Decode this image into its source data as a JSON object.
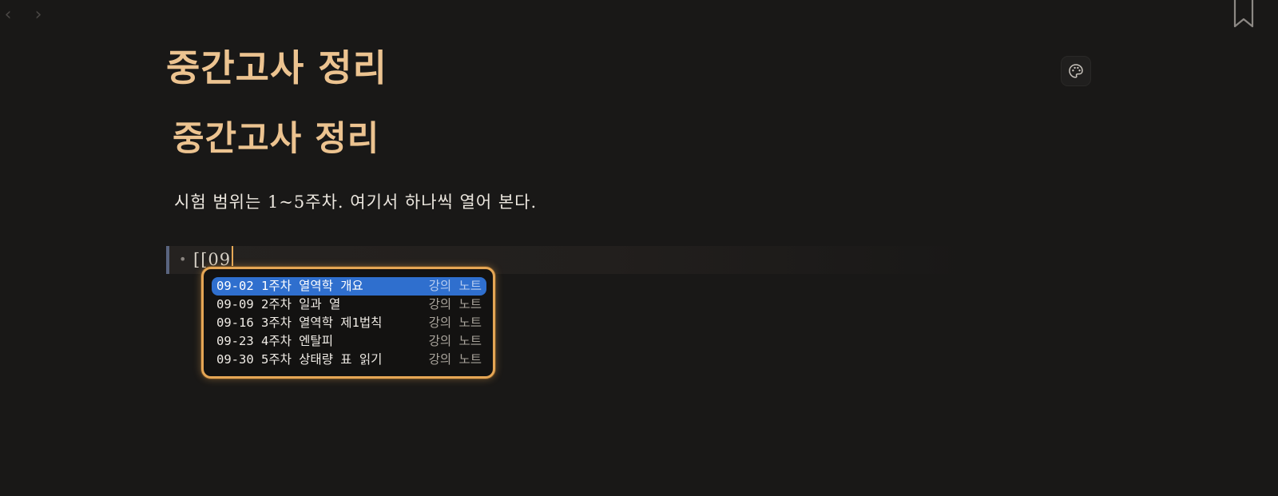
{
  "nav": {
    "back_icon": "chevron-left-icon",
    "forward_icon": "chevron-right-icon",
    "back_glyph": "‹",
    "forward_glyph": "›"
  },
  "toolbar": {
    "bookmark_icon": "bookmark-icon",
    "palette_icon": "palette-icon"
  },
  "document": {
    "title": "중간고사 정리",
    "heading": "중간고사 정리",
    "paragraph": "시험 범위는 1~5주차. 여기서 하나씩 열어 본다.",
    "bullet_input": "[[09"
  },
  "autocomplete": {
    "selected_index": 0,
    "items": [
      {
        "title": "09-02 1주차 열역학 개요",
        "kind": "강의 노트"
      },
      {
        "title": "09-09 2주차 일과 열",
        "kind": "강의 노트"
      },
      {
        "title": "09-16 3주차 열역학 제1법칙",
        "kind": "강의 노트"
      },
      {
        "title": "09-23 4주차 엔탈피",
        "kind": "강의 노트"
      },
      {
        "title": "09-30 5주차 상태량 표 읽기",
        "kind": "강의 노트"
      }
    ]
  },
  "colors": {
    "background": "#191817",
    "title_accent": "#ecc390",
    "selection": "#2f6fce",
    "popup_border": "#e5a655",
    "bullet_bar": "#59647f"
  }
}
